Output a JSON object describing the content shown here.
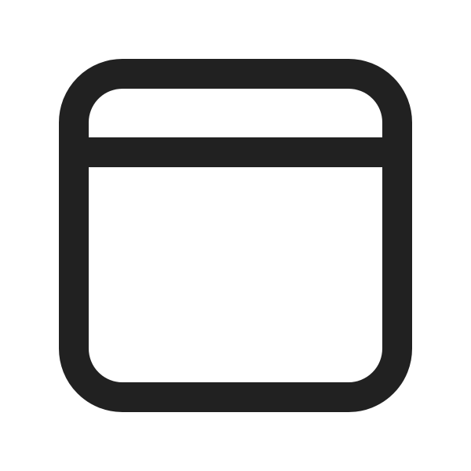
{
  "icon": {
    "name": "app-window-icon",
    "stroke_color": "#212121",
    "background_color": "#ffffff"
  }
}
